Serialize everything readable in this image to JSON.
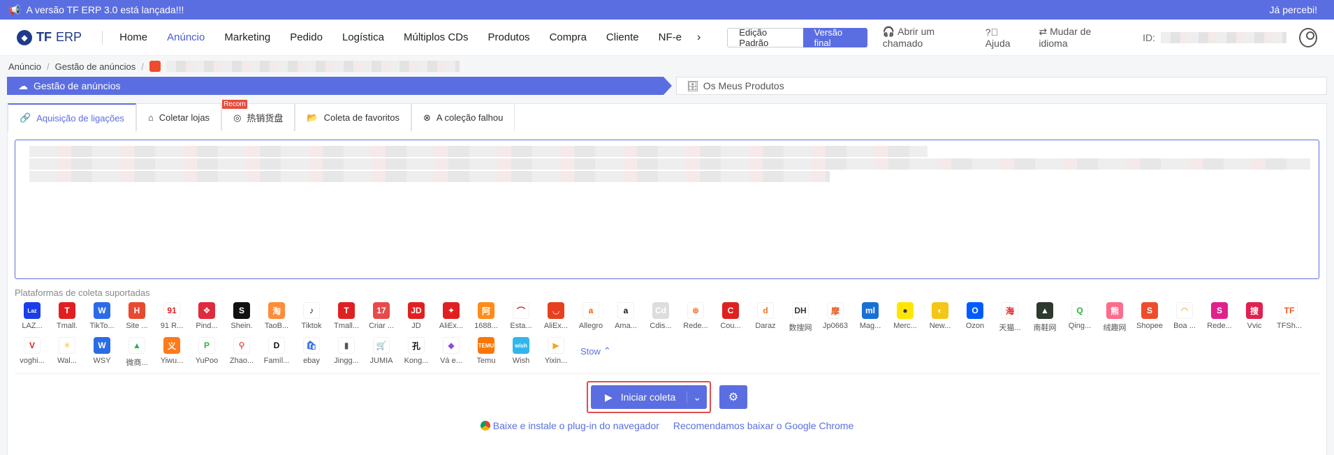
{
  "banner": {
    "message": "A versão TF ERP 3.0 está lançada!!!",
    "dismiss": "Já percebi!"
  },
  "logo": {
    "brand": "TF",
    "product": "ERP"
  },
  "menu": [
    "Home",
    "Anúncio",
    "Marketing",
    "Pedido",
    "Logística",
    "Múltiplos CDs",
    "Produtos",
    "Compra",
    "Cliente",
    "NF-e"
  ],
  "edition": {
    "standard": "Edição Padrão",
    "final": "Versão final"
  },
  "toplinks": {
    "ticket": "Abrir um chamado",
    "help": "Ajuda",
    "language": "Mudar de idioma",
    "id_label": "ID:"
  },
  "breadcrumb": {
    "first": "Anúncio",
    "second": "Gestão de anúncios"
  },
  "steps": {
    "current": "Gestão de anúncios",
    "next": "Os Meus Produtos"
  },
  "tabs": [
    {
      "label": "Aquisição de ligações",
      "icon": "link-icon"
    },
    {
      "label": "Coletar lojas",
      "icon": "home-icon"
    },
    {
      "label": "热销货盘",
      "icon": "target-icon",
      "badge": "Recom"
    },
    {
      "label": "Coleta de favoritos",
      "icon": "folder-icon"
    },
    {
      "label": "A coleção falhou",
      "icon": "close-circle-icon"
    }
  ],
  "platforms_label": "Plataformas de coleta suportadas",
  "platforms": [
    {
      "label": "LAZ...",
      "color": "#1a3ee8",
      "glyph": "Laz"
    },
    {
      "label": "Tmall.",
      "color": "#e02020",
      "glyph": "T"
    },
    {
      "label": "TikTo...",
      "color": "#2c6be8",
      "glyph": "W"
    },
    {
      "label": "Site ...",
      "color": "#e84a2f",
      "glyph": "H"
    },
    {
      "label": "91 R...",
      "color": "#ffffff",
      "glyph": "91",
      "fg": "#e02020"
    },
    {
      "label": "Pind...",
      "color": "#e02b3c",
      "glyph": "❖"
    },
    {
      "label": "Shein.",
      "color": "#111111",
      "glyph": "S"
    },
    {
      "label": "TaoB...",
      "color": "#ff8c3a",
      "glyph": "淘"
    },
    {
      "label": "Tiktok",
      "color": "#ffffff",
      "glyph": "♪",
      "fg": "#111"
    },
    {
      "label": "Tmall...",
      "color": "#e02020",
      "glyph": "T"
    },
    {
      "label": "Criar ...",
      "color": "#e84a4a",
      "glyph": "17"
    },
    {
      "label": "JD",
      "color": "#e02020",
      "glyph": "JD"
    },
    {
      "label": "AliEx...",
      "color": "#e02020",
      "glyph": "✦"
    },
    {
      "label": "1688...",
      "color": "#ff8c1a",
      "glyph": "阿"
    },
    {
      "label": "Esta...",
      "color": "#ffffff",
      "glyph": "⌒",
      "fg": "#e02020"
    },
    {
      "label": "AliEx...",
      "color": "#e8401f",
      "glyph": "◡"
    },
    {
      "label": "Allegro",
      "color": "#ffffff",
      "glyph": "a",
      "fg": "#ff5a00"
    },
    {
      "label": "Ama...",
      "color": "#ffffff",
      "glyph": "a",
      "fg": "#111"
    },
    {
      "label": "Cdis...",
      "color": "#dddddd",
      "glyph": "Cd"
    },
    {
      "label": "Rede...",
      "color": "#ffffff",
      "glyph": "⊛",
      "fg": "#e8601f"
    },
    {
      "label": "Cou...",
      "color": "#e02020",
      "glyph": "C"
    },
    {
      "label": "Daraz",
      "color": "#ffffff",
      "glyph": "d",
      "fg": "#f57224"
    },
    {
      "label": "数搜网",
      "color": "#ffffff",
      "glyph": "DH",
      "fg": "#333"
    },
    {
      "label": "Jp0663",
      "color": "#ffffff",
      "glyph": "摩",
      "fg": "#e85a1f"
    },
    {
      "label": "Mag...",
      "color": "#1a6fd4",
      "glyph": "ml"
    },
    {
      "label": "Merc...",
      "color": "#ffe600",
      "glyph": "●",
      "fg": "#2d3277"
    },
    {
      "label": "New...",
      "color": "#f5c518",
      "glyph": "◐"
    },
    {
      "label": "Ozon",
      "color": "#005bff",
      "glyph": "O"
    },
    {
      "label": "天猫...",
      "color": "#ffffff",
      "glyph": "海",
      "fg": "#e02020"
    },
    {
      "label": "南鞋网",
      "color": "#2d3a2d",
      "glyph": "▲"
    },
    {
      "label": "Qing...",
      "color": "#ffffff",
      "glyph": "Q",
      "fg": "#2db34a"
    },
    {
      "label": "绒趣网",
      "color": "#ff6b8a",
      "glyph": "熊"
    },
    {
      "label": "Shopee",
      "color": "#ee4d2d",
      "glyph": "S"
    },
    {
      "label": "Boa ...",
      "color": "#ffffff",
      "glyph": "◠",
      "fg": "#f08a00"
    },
    {
      "label": "Rede...",
      "color": "#e0208c",
      "glyph": "S"
    },
    {
      "label": "Vvic",
      "color": "#e02050",
      "glyph": "搜"
    },
    {
      "label": "TFSh...",
      "color": "#ffffff",
      "glyph": "TF",
      "fg": "#e85a1f"
    },
    {
      "label": "voghi...",
      "color": "#ffffff",
      "glyph": "V",
      "fg": "#e02020"
    },
    {
      "label": "Wal...",
      "color": "#ffffff",
      "glyph": "✳",
      "fg": "#ffc220"
    },
    {
      "label": "WSY",
      "color": "#2c6be8",
      "glyph": "W"
    },
    {
      "label": "微商...",
      "color": "#ffffff",
      "glyph": "▲",
      "fg": "#2db34a"
    },
    {
      "label": "Yiwu...",
      "color": "#ff7a1a",
      "glyph": "义"
    },
    {
      "label": "YuPoo",
      "color": "#ffffff",
      "glyph": "P",
      "fg": "#2db34a"
    },
    {
      "label": "Zhao...",
      "color": "#ffffff",
      "glyph": "⚲",
      "fg": "#e02020"
    },
    {
      "label": "Famíl...",
      "color": "#ffffff",
      "glyph": "D",
      "fg": "#111"
    },
    {
      "label": "ebay",
      "color": "#ffffff",
      "glyph": "🛍",
      "fg": "#2c6be8"
    },
    {
      "label": "Jingg...",
      "color": "#ffffff",
      "glyph": "▮",
      "fg": "#555"
    },
    {
      "label": "JUMIA",
      "color": "#ffffff",
      "glyph": "🛒",
      "fg": "#f68b1e"
    },
    {
      "label": "Kong...",
      "color": "#ffffff",
      "glyph": "孔",
      "fg": "#111"
    },
    {
      "label": "Vá e...",
      "color": "#ffffff",
      "glyph": "◆",
      "fg": "#8a4ae8"
    },
    {
      "label": "Temu",
      "color": "#fb7701",
      "glyph": "TEMU"
    },
    {
      "label": "Wish",
      "color": "#2fb7ec",
      "glyph": "wish"
    },
    {
      "label": "Yixin...",
      "color": "#ffffff",
      "glyph": "▶",
      "fg": "#f5a623"
    }
  ],
  "stow": "Stow",
  "actions": {
    "start": "Iniciar coleta"
  },
  "links": {
    "plugin": "Baixe e instale o plug-in do navegador",
    "chrome": "Recomendamos baixar o Google Chrome"
  }
}
